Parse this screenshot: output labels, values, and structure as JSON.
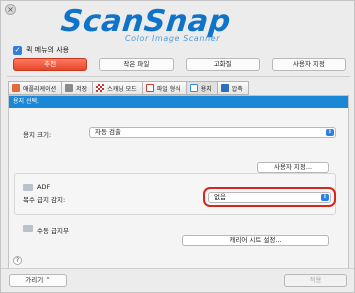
{
  "app": {
    "logo_word": "ScanSnap",
    "logo_sub": "Color Image Scanner"
  },
  "quick_menu": {
    "label": "퀵 메뉴의 사용",
    "checked": true
  },
  "presets": [
    {
      "label": "추천",
      "active": true
    },
    {
      "label": "작은 파일",
      "active": false
    },
    {
      "label": "고화질",
      "active": false
    },
    {
      "label": "사용자 지정",
      "active": false
    }
  ],
  "tabs": [
    {
      "label": "애플리케이션",
      "icon": "application-icon",
      "color": "#e46a3c"
    },
    {
      "label": "저장",
      "icon": "save-icon",
      "color": "#8a8a8a"
    },
    {
      "label": "스캐닝 모드",
      "icon": "scan-mode-icon",
      "color": "#c9302c"
    },
    {
      "label": "파일 형식",
      "icon": "file-format-icon",
      "color": "#d23c2c"
    },
    {
      "label": "용지",
      "icon": "paper-icon",
      "color": "#3a8fd8",
      "active": true
    },
    {
      "label": "압축",
      "icon": "compress-icon",
      "color": "#2f6fb8"
    }
  ],
  "section": {
    "title": "용지 선택."
  },
  "paper_size": {
    "label": "용지 크기:",
    "value": "자동 검출"
  },
  "custom_button": "사용자 지정...",
  "adf": {
    "title": "ADF",
    "icon": "adf-icon"
  },
  "multifeed": {
    "label": "복수 급지 감지:",
    "value": "없음"
  },
  "manual_feed": {
    "label": "수동 급지부",
    "icon": "manual-feed-icon"
  },
  "carrier_button": "캐리어 시트 설정...",
  "help": "?",
  "bottom": {
    "hide_button": "가리기 ⌃",
    "apply_button": "적용"
  },
  "colors": {
    "accent_blue": "#1a88d6",
    "preset_active": "#e5472c",
    "highlight": "#d7261b"
  }
}
